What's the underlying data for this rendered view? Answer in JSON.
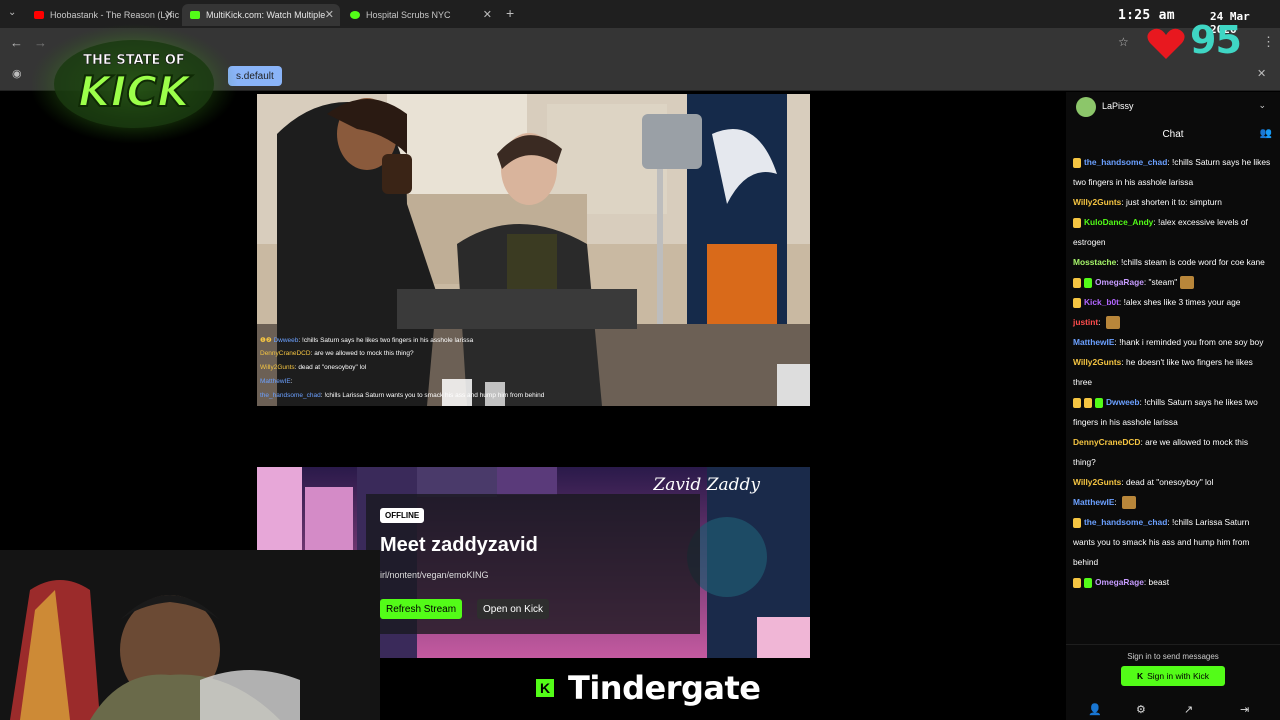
{
  "browser": {
    "tabs": [
      {
        "label": "Hoobastank - The Reason (Lyric",
        "favicon_color": "#ff0000",
        "active": false
      },
      {
        "label": "MultiKick.com: Watch Multiple",
        "favicon_color": "#53fc18",
        "active": true
      },
      {
        "label": "Hospital Scrubs NYC",
        "favicon_color": "#53fc18",
        "active": false
      }
    ],
    "new_tab": "+",
    "bookmark_chip": "s.default"
  },
  "overlay": {
    "time": "1:25 am",
    "date": "24 Mar 2026",
    "viewer_count": "95",
    "logo_line1": "THE STATE OF",
    "logo_line2": "KICK",
    "ticker_text": "Tindergate",
    "ticker_icon": "K",
    "accent": "#53fc18"
  },
  "stream1": {
    "chat_overlay": [
      {
        "user": "Dwweeb",
        "text": "!chills Saturn says he likes two fingers in his asshole larissa",
        "user_color": "#6ba0ff"
      },
      {
        "user": "DennyCraneDCD",
        "text": "are we allowed to mock this thing?",
        "user_color": "#f5c542"
      },
      {
        "user": "Willy2Gunts",
        "text": "dead at \"onesoyboy\" lol",
        "user_color": "#f5c542"
      },
      {
        "user": "MatthewIE",
        "text": "",
        "user_color": "#6ba0ff"
      },
      {
        "user": "the_handsome_chad",
        "text": "!chills Larissa Saturn wants you to smack his ass and hump him from behind",
        "user_color": "#6ba0ff"
      }
    ]
  },
  "stream2": {
    "banner_title": "Zavid Zaddy",
    "status": "OFFLINE",
    "heading": "Meet zaddyzavid",
    "subtitle": "irl/nontent/vegan/emoKING",
    "refresh_label": "Refresh Stream",
    "open_label": "Open on Kick"
  },
  "chat": {
    "channel": "LaPissy",
    "title": "Chat",
    "messages": [
      {
        "user": "the_handsome_chad",
        "color": "#6ba0ff",
        "badges": [
          "badge"
        ],
        "text": "!chills Saturn says he likes two fingers in his asshole larissa"
      },
      {
        "user": "Willy2Gunts",
        "color": "#f5c542",
        "badges": [],
        "text": "just shorten it to: simpturn"
      },
      {
        "user": "KuloDance_Andy",
        "color": "#53fc18",
        "badges": [
          "badge"
        ],
        "text": "!alex excessive levels of estrogen"
      },
      {
        "user": "Mosstache",
        "color": "#a6f56a",
        "badges": [],
        "text": "!chills steam is code word for coe kane"
      },
      {
        "user": "OmegaRage",
        "color": "#c69cff",
        "badges": [
          "badge",
          "sub"
        ],
        "text": "\"steam\"",
        "emote": true
      },
      {
        "user": "Kick_b0t",
        "color": "#b266ff",
        "badges": [
          "badge"
        ],
        "text": "!alex shes like 3 times your age"
      },
      {
        "user": "justint",
        "color": "#ff4d4d",
        "badges": [],
        "text": "",
        "emote": true
      },
      {
        "user": "MatthewIE",
        "color": "#6ba0ff",
        "badges": [],
        "text": "!hank i reminded you from one soy boy"
      },
      {
        "user": "Willy2Gunts",
        "color": "#f5c542",
        "badges": [],
        "text": "he doesn't like two fingers he likes three"
      },
      {
        "user": "Dwweeb",
        "color": "#6ba0ff",
        "badges": [
          "badge",
          "badge",
          "sub"
        ],
        "text": "!chills Saturn says he likes two fingers in his asshole larissa"
      },
      {
        "user": "DennyCraneDCD",
        "color": "#f5c542",
        "badges": [],
        "text": "are we allowed to mock this thing?"
      },
      {
        "user": "Willy2Gunts",
        "color": "#f5c542",
        "badges": [],
        "text": "dead at \"onesoyboy\" lol"
      },
      {
        "user": "MatthewIE",
        "color": "#6ba0ff",
        "badges": [],
        "text": "",
        "emote": true
      },
      {
        "user": "the_handsome_chad",
        "color": "#6ba0ff",
        "badges": [
          "badge"
        ],
        "text": "!chills Larissa Saturn wants you to smack his ass and hump him from behind"
      },
      {
        "user": "OmegaRage",
        "color": "#c69cff",
        "badges": [
          "badge",
          "sub"
        ],
        "text": "beast"
      }
    ],
    "sign_in_prompt": "Sign in to send messages",
    "sign_in_button": "Sign in with Kick"
  }
}
